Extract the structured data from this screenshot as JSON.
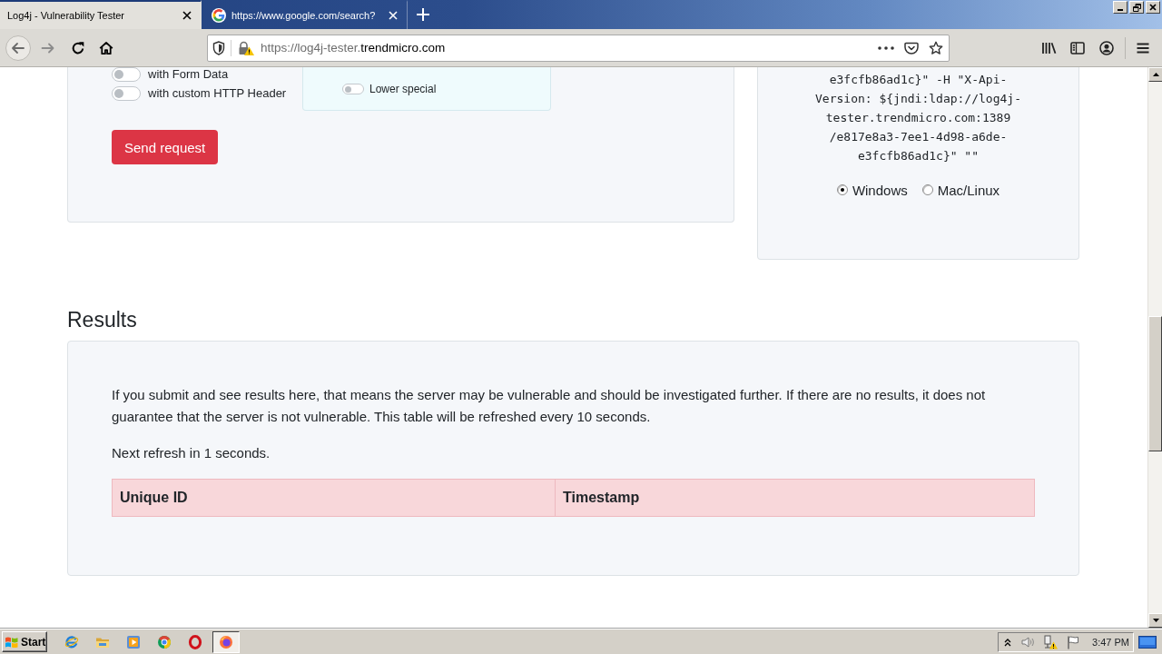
{
  "browser": {
    "tabs": [
      {
        "title": "Log4j - Vulnerability Tester",
        "selected": true,
        "favicon": false
      },
      {
        "title": "https://www.google.com/search?",
        "selected": false,
        "favicon": true
      }
    ],
    "address_bar": {
      "url_host_prefix": "https://log4j-tester.",
      "url_domain": "trendmicro.com"
    }
  },
  "test_form": {
    "options": [
      {
        "label": "with Form Data",
        "on": false
      },
      {
        "label": "with custom HTTP Header",
        "on": false
      }
    ],
    "case_options": [
      {
        "label": "Lower special",
        "on": false
      }
    ],
    "submit_button": "Send request"
  },
  "command_panel": {
    "command": "e3fcfb86ad1c}\" -H \"X-Api-\nVersion: ${jndi:ldap://log4j-\ntester.trendmicro.com:1389\n/e817e8a3-7ee1-4d98-a6de-\ne3fcfb86ad1c}\" \"\"",
    "platforms": [
      {
        "label": "Windows",
        "selected": true
      },
      {
        "label": "Mac/Linux",
        "selected": false
      }
    ]
  },
  "results": {
    "title": "Results",
    "description": "If you submit and see results here, that means the server may be vulnerable and should be investigated further. If there are no results, it does not guarantee that the server is not vulnerable. This table will be refreshed every 10 seconds.",
    "refresh_note": "Next refresh in 1 seconds.",
    "table": {
      "columns": [
        "Unique ID",
        "Timestamp"
      ]
    }
  },
  "taskbar": {
    "start_button": "Start",
    "apps": [
      {
        "kind": "ie",
        "selected": false
      },
      {
        "kind": "explorer",
        "selected": false
      },
      {
        "kind": "media_player",
        "selected": false
      },
      {
        "kind": "chrome",
        "selected": false
      },
      {
        "kind": "opera",
        "selected": false
      },
      {
        "kind": "firefox",
        "selected": true
      }
    ],
    "clock": "3:47 PM"
  }
}
